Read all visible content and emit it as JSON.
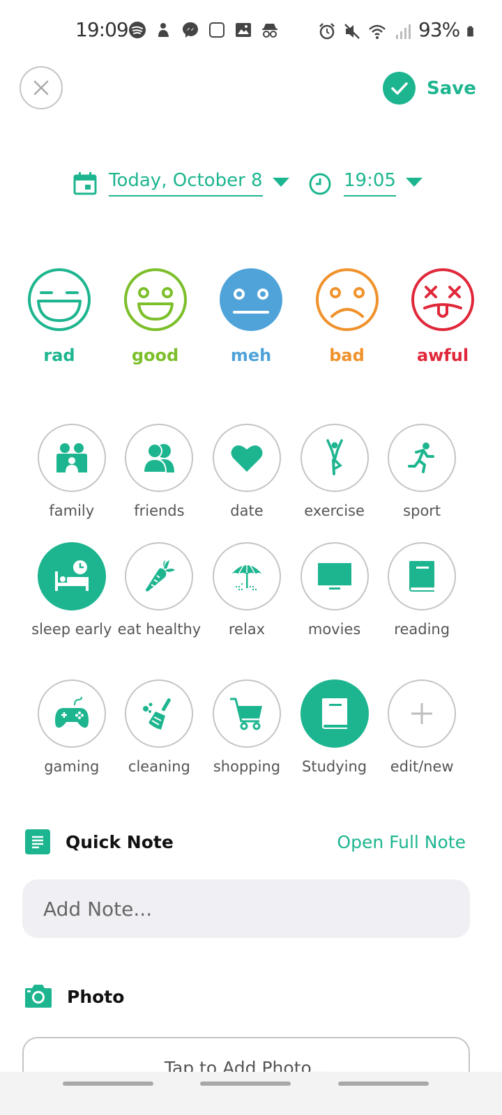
{
  "status_bar": {
    "time": "19:09",
    "battery": "93%",
    "left_icons": [
      "spotify-icon",
      "user-status-icon",
      "messenger-icon",
      "square-icon",
      "gallery-icon",
      "incognito-icon"
    ],
    "right_icons": [
      "alarm-icon",
      "mute-icon",
      "wifi-icon",
      "signal-icon",
      "battery-icon"
    ]
  },
  "header": {
    "save_label": "Save"
  },
  "datetime": {
    "date": "Today, October 8",
    "time": "19:05"
  },
  "colors": {
    "accent": "#1db58f",
    "rad": "#1db58f",
    "good": "#7cbf2a",
    "meh": "#4fa3d9",
    "bad": "#f0922b",
    "awful": "#e0283a"
  },
  "moods": [
    {
      "key": "rad",
      "label": "rad",
      "color": "#1db58f",
      "selected": false
    },
    {
      "key": "good",
      "label": "good",
      "color": "#7cbf2a",
      "selected": false
    },
    {
      "key": "meh",
      "label": "meh",
      "color": "#4fa3d9",
      "selected": true
    },
    {
      "key": "bad",
      "label": "bad",
      "color": "#f0922b",
      "selected": false
    },
    {
      "key": "awful",
      "label": "awful",
      "color": "#e0283a",
      "selected": false
    }
  ],
  "activities": [
    {
      "label": "family",
      "icon": "family-icon",
      "selected": false
    },
    {
      "label": "friends",
      "icon": "friends-icon",
      "selected": false
    },
    {
      "label": "date",
      "icon": "heart-icon",
      "selected": false
    },
    {
      "label": "exercise",
      "icon": "exercise-icon",
      "selected": false
    },
    {
      "label": "sport",
      "icon": "running-icon",
      "selected": false
    },
    {
      "label": "sleep early",
      "icon": "bed-clock-icon",
      "selected": true
    },
    {
      "label": "eat healthy",
      "icon": "carrot-icon",
      "selected": false
    },
    {
      "label": "relax",
      "icon": "beach-umbrella-icon",
      "selected": false
    },
    {
      "label": "movies",
      "icon": "tv-icon",
      "selected": false
    },
    {
      "label": "reading",
      "icon": "book-icon",
      "selected": false
    },
    {
      "label": "gaming",
      "icon": "gamepad-icon",
      "selected": false
    },
    {
      "label": "cleaning",
      "icon": "broom-icon",
      "selected": false
    },
    {
      "label": "shopping",
      "icon": "cart-icon",
      "selected": false
    },
    {
      "label": "Studying",
      "icon": "book-icon",
      "selected": true
    },
    {
      "label": "edit/new",
      "icon": "plus-icon",
      "selected": false
    }
  ],
  "quick_note": {
    "title": "Quick Note",
    "open_full": "Open Full Note",
    "placeholder": "Add Note..."
  },
  "photo": {
    "title": "Photo",
    "button_label": "Tap to Add Photo..."
  }
}
